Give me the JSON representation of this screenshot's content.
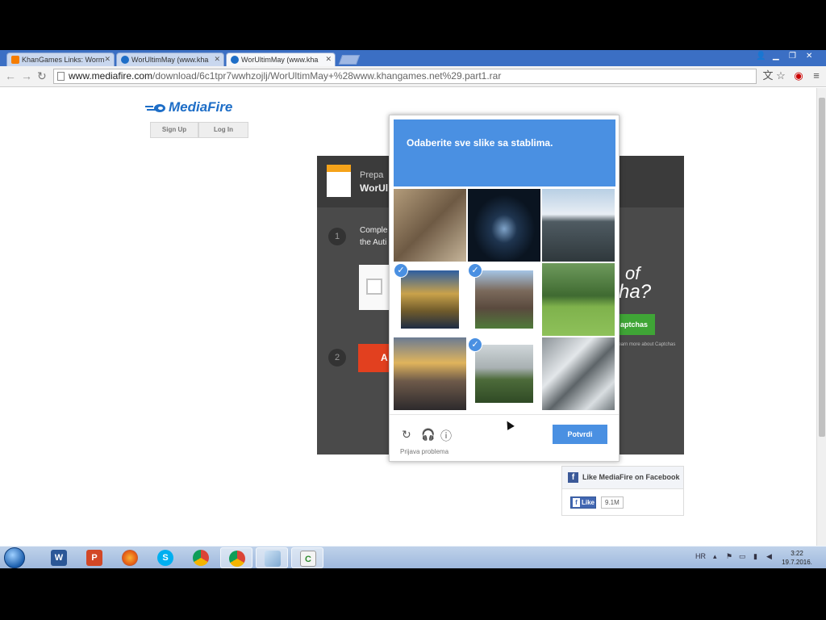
{
  "browser": {
    "tabs": [
      {
        "title": "KhanGames Links: Worm"
      },
      {
        "title": "WorUltimMay (www.kha"
      },
      {
        "title": "WorUltimMay (www.kha"
      }
    ],
    "url": {
      "scheme_host": "www.mediafire.com",
      "path": "/download/6c1tpr7wwhzojlj/WorUltimMay+%28www.khangames.net%29.part1.rar"
    }
  },
  "page": {
    "logo_text": "MediaFire",
    "sign_up_label": "Sign Up",
    "log_in_label": "Log In",
    "download_panel": {
      "file_line1": "Prepa",
      "file_line2": "WorUl",
      "step1_number": "1",
      "step1_text_line1": "Comple",
      "step1_text_line2": "the Auti",
      "step2_number": "2",
      "download_button_fragment": "A",
      "promo_word1": "of",
      "promo_word2": "cha?",
      "promo_button": "aptchas",
      "promo_note": "Learn more about Captchas"
    },
    "facebook": {
      "heading": "Like MediaFire on Facebook",
      "like_label": "Like",
      "like_count": "9.1M"
    }
  },
  "recaptcha": {
    "instruction_prefix": "Odaberite sve slike sa ",
    "instruction_keyword": "stablima",
    "instruction_suffix": ".",
    "tiles": [
      {
        "subject": "metal-sculpture",
        "selected": false
      },
      {
        "subject": "night-bridge",
        "selected": false
      },
      {
        "subject": "pier-over-water",
        "selected": false
      },
      {
        "subject": "tree-by-river",
        "selected": true
      },
      {
        "subject": "church",
        "selected": true
      },
      {
        "subject": "park-with-trees",
        "selected": false
      },
      {
        "subject": "sunset-over-city",
        "selected": false
      },
      {
        "subject": "hilltop-trees",
        "selected": true
      },
      {
        "subject": "snowy-mountains",
        "selected": false
      }
    ],
    "report_label": "Prijava problema",
    "verify_label": "Potvrdi"
  },
  "taskbar": {
    "language": "HR",
    "time": "3:22",
    "date": "19.7.2016."
  },
  "colors": {
    "recaptcha_blue": "#4a90e2",
    "mediafire_blue": "#1e6ec7",
    "download_red": "#e2401f",
    "promo_green": "#3fa536",
    "facebook_blue": "#3b5998"
  }
}
